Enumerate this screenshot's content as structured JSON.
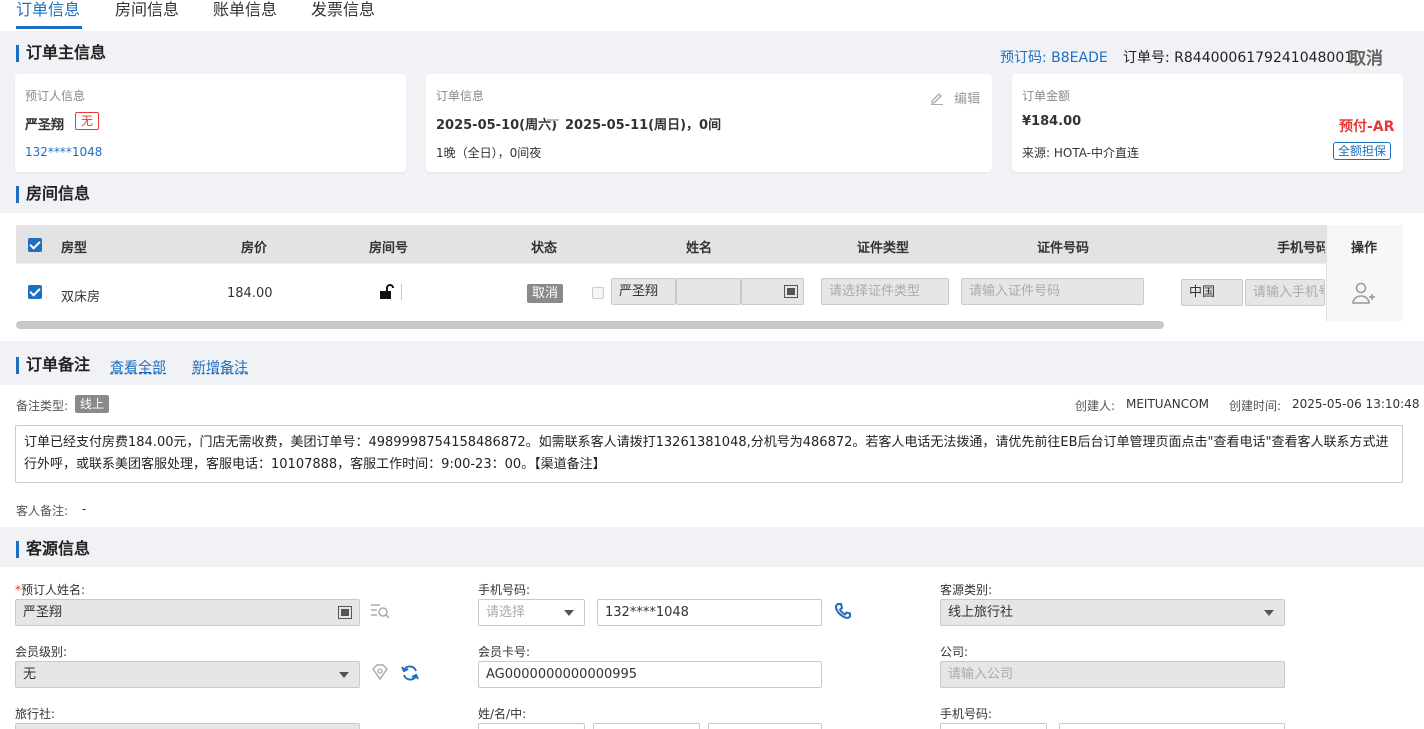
{
  "tabs": [
    {
      "label": "订单信息"
    },
    {
      "label": "房间信息"
    },
    {
      "label": "账单信息"
    },
    {
      "label": "发票信息"
    }
  ],
  "main_section": {
    "title": "订单主信息",
    "booking_code": "预订码: B8EADE",
    "order_no": "订单号: R8440006179241048001",
    "cancel_label": "取消"
  },
  "booker_card": {
    "label": "预订人信息",
    "name": "严圣翔",
    "badge": "无",
    "phone": "132****1048"
  },
  "order_card": {
    "label": "订单信息",
    "edit_label": "编辑",
    "date_from": "2025-05-10(周六)",
    "date_to": "2025-05-11(周日)，0间",
    "nights": "1晚（全日），0间夜"
  },
  "amount_card": {
    "label": "订单金额",
    "amount": "¥184.00",
    "pay_type": "预付-AR",
    "source": "来源: HOTA-中介直连",
    "guarantee": "全额担保"
  },
  "room_section": {
    "title": "房间信息",
    "headers": {
      "type": "房型",
      "price": "房价",
      "room_no": "房间号",
      "status": "状态",
      "name": "姓名",
      "id_type": "证件类型",
      "id_no": "证件号码",
      "phone": "手机号码",
      "action": "操作"
    },
    "row": {
      "type": "双床房",
      "price": "184.00",
      "status": "取消",
      "name": "严圣翔",
      "id_type_placeholder": "请选择证件类型",
      "id_no_placeholder": "请输入证件号码",
      "country": "中国",
      "phone_placeholder": "请输入手机号"
    }
  },
  "remark_section": {
    "title": "订单备注",
    "view_all": "查看全部",
    "add_remark": "新增备注",
    "type_label": "备注类型:",
    "type_value": "线上",
    "creator_label": "创建人:",
    "creator": "MEITUANCOM",
    "time_label": "创建时间:",
    "time": "2025-05-06 13:10:48",
    "content": "订单已经支付房费184.00元，门店无需收费，美团订单号：4989998754158486872。如需联系客人请拨打13261381048,分机号为486872。若客人电话无法拨通，请优先前往EB后台订单管理页面点击\"查看电话\"查看客人联系方式进行外呼，或联系美团客服处理，客服电话：10107888，客服工作时间：9:00-23：00。【渠道备注】",
    "guest_remark_label": "客人备注:",
    "guest_remark": "-"
  },
  "source_section": {
    "title": "客源信息",
    "booker_name_label": "预订人姓名:",
    "booker_name": "严圣翔",
    "phone_label": "手机号码:",
    "phone_prefix_placeholder": "请选择",
    "phone_value": "132****1048",
    "source_type_label": "客源类别:",
    "source_type": "线上旅行社",
    "member_level_label": "会员级别:",
    "member_level": "无",
    "member_card_label": "会员卡号:",
    "member_card": "AG0000000000000995",
    "company_label": "公司:",
    "company_placeholder": "请输入公司",
    "agency_label": "旅行社:",
    "name_parts_label": "姓/名/中:",
    "phone2_label": "手机号码:"
  },
  "colors": {
    "accent": "#1f6fc0",
    "danger": "#e53935"
  }
}
